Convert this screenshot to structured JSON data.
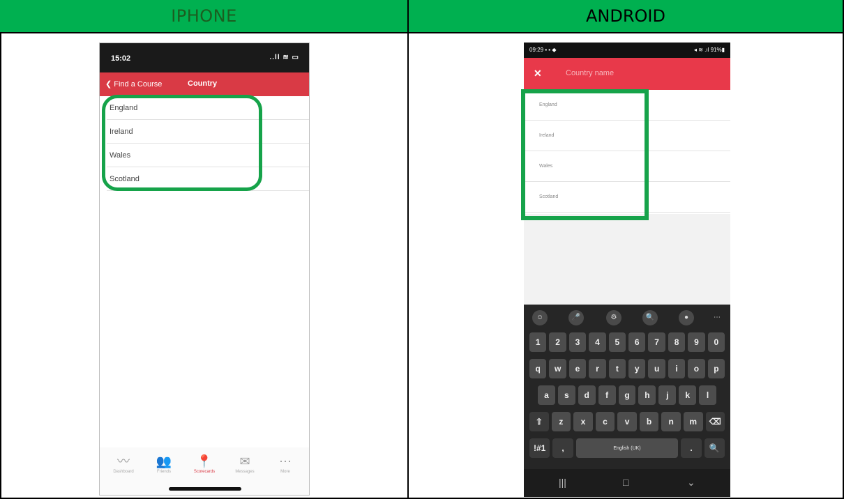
{
  "headers": {
    "iphone": "IPHONE",
    "android": "ANDROID"
  },
  "iphone": {
    "status_time": "15:02",
    "status_icons": "..ll ≋ ▭",
    "back_label": "❮ Find a Course",
    "title": "Country",
    "countries": [
      "England",
      "Ireland",
      "Wales",
      "Scotland"
    ],
    "tabs": [
      {
        "label": "Dashboard",
        "icon": "chart-line-icon",
        "glyph": "〰"
      },
      {
        "label": "Friends",
        "icon": "friends-icon",
        "glyph": "👥"
      },
      {
        "label": "Scorecards",
        "icon": "location-pin-icon",
        "glyph": "📍"
      },
      {
        "label": "Messages",
        "icon": "envelope-icon",
        "glyph": "✉"
      },
      {
        "label": "More",
        "icon": "more-icon",
        "glyph": "⋯"
      }
    ],
    "accent_color": "#d93a45"
  },
  "android": {
    "status_time": "09:29 ▪ ▪ ◆",
    "status_icons": "◂ ≋ .ıl 91%▮",
    "close_glyph": "✕",
    "search_placeholder": "Country name",
    "countries": [
      "England",
      "Ireland",
      "Wales",
      "Scotland"
    ],
    "keyboard": {
      "tools": [
        "☺",
        "🎤",
        "⚙",
        "🔍",
        "●",
        "⋯"
      ],
      "row_numbers": [
        "1",
        "2",
        "3",
        "4",
        "5",
        "6",
        "7",
        "8",
        "9",
        "0"
      ],
      "row_top": [
        "q",
        "w",
        "e",
        "r",
        "t",
        "y",
        "u",
        "i",
        "o",
        "p"
      ],
      "row_home": [
        "a",
        "s",
        "d",
        "f",
        "g",
        "h",
        "j",
        "k",
        "l"
      ],
      "row_bottom": [
        "⇧",
        "z",
        "x",
        "c",
        "v",
        "b",
        "n",
        "m",
        "⌫"
      ],
      "row_space": [
        "!#1",
        ",",
        "English (UK)",
        ".",
        "🔍"
      ]
    },
    "nav": [
      "|||",
      "□",
      "⌄"
    ],
    "accent_color": "#e8394a"
  },
  "highlight_color": "#16a34a"
}
